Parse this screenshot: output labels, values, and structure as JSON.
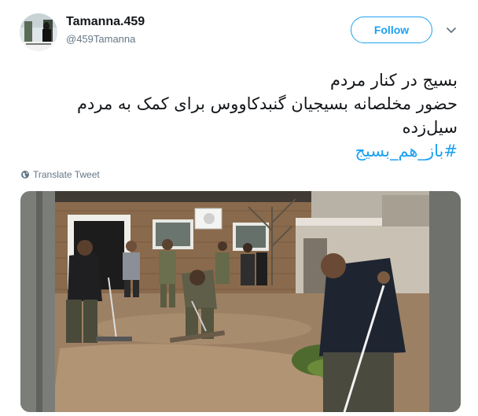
{
  "user": {
    "display_name": "Tamanna.459",
    "handle": "@459Tamanna",
    "avatar_icon": "profile-photo"
  },
  "follow_button": {
    "label": "Follow",
    "color": "#1da1f2"
  },
  "menu": {
    "icon": "chevron-down-icon"
  },
  "tweet": {
    "lines": [
      "بسیج در کنار مردم",
      "حضور مخلصانه بسیجیان گنبدکاووس برای کمک به مردم",
      "سیل‌زده"
    ],
    "hashtag": "#باز_هم_بسیج"
  },
  "translate": {
    "label": "Translate Tweet",
    "icon": "globe-icon"
  },
  "media": {
    "type": "photo",
    "subject": "flood-cleanup"
  },
  "colors": {
    "accent": "#1da1f2",
    "secondary_text": "#657786",
    "primary_text": "#14171a"
  }
}
